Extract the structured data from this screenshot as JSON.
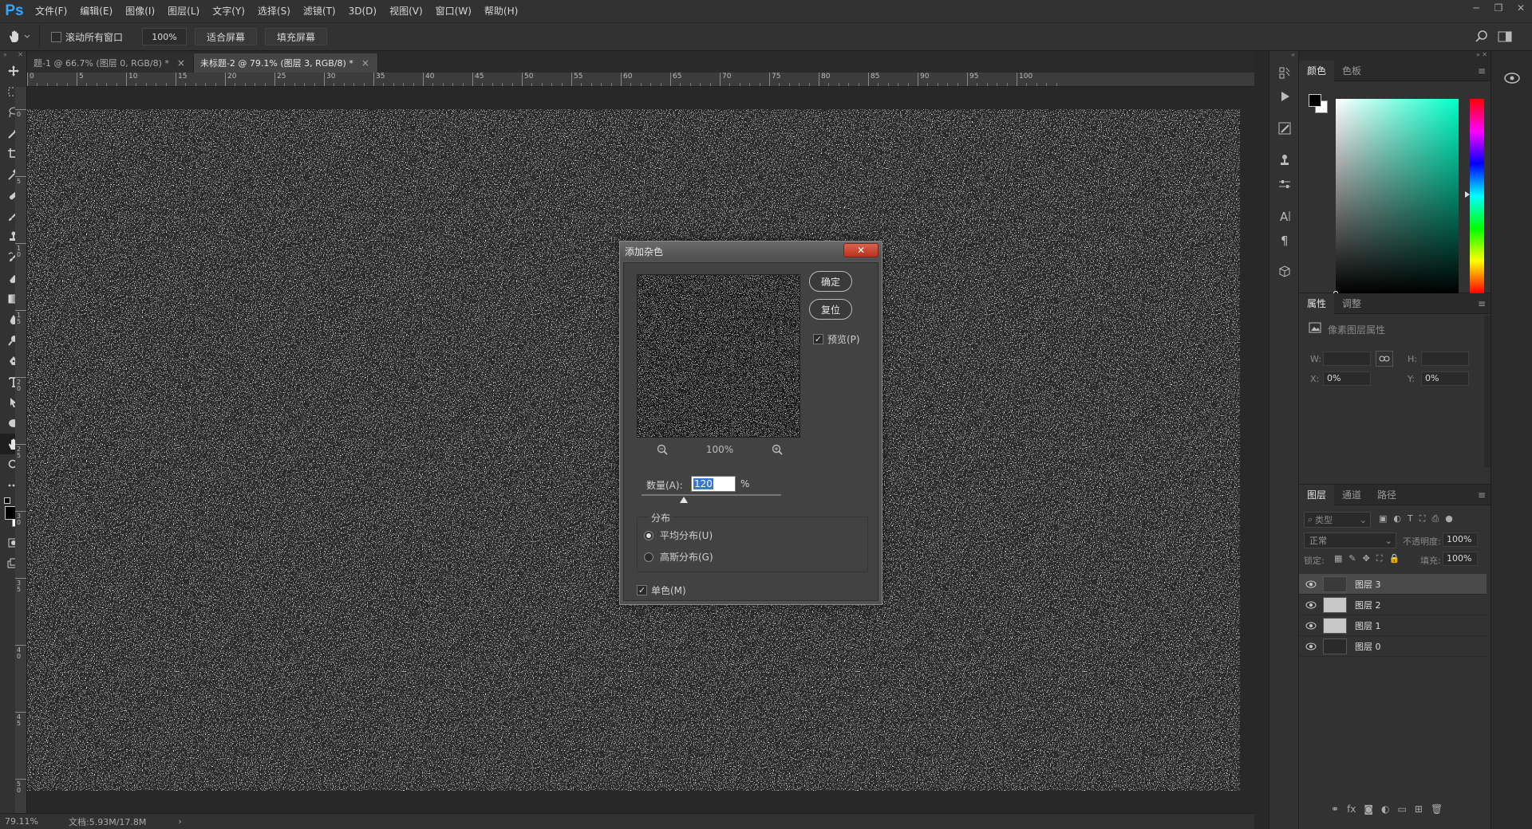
{
  "app": {
    "logo": "Ps"
  },
  "menu": [
    "文件(F)",
    "编辑(E)",
    "图像(I)",
    "图层(L)",
    "文字(Y)",
    "选择(S)",
    "滤镜(T)",
    "3D(D)",
    "视图(V)",
    "窗口(W)",
    "帮助(H)"
  ],
  "options": {
    "scroll_all_label": "滚动所有窗口",
    "zoom_value": "100%",
    "fit_screen_label": "适合屏幕",
    "fill_screen_label": "填充屏幕"
  },
  "tabs": [
    {
      "label": "题-1 @ 66.7% (图层 0, RGB/8) *",
      "active": false
    },
    {
      "label": "未标题-2 @ 79.1% (图层 3, RGB/8) *",
      "active": true
    }
  ],
  "ruler_h": [
    "0",
    "5",
    "10",
    "15",
    "20",
    "25",
    "30",
    "35",
    "40",
    "45",
    "50",
    "55",
    "60",
    "65",
    "70",
    "75",
    "80",
    "85",
    "90",
    "95",
    "100"
  ],
  "ruler_v": [
    "0",
    "5",
    "10",
    "15",
    "20",
    "25",
    "30",
    "35",
    "40",
    "45",
    "50"
  ],
  "status": {
    "zoom": "79.11%",
    "doc": "文档:5.93M/17.8M"
  },
  "dialog": {
    "title": "添加杂色",
    "ok_label": "确定",
    "reset_label": "复位",
    "preview_label": "预览(P)",
    "preview_checked": true,
    "zoom": "100%",
    "amount_label": "数量(A):",
    "amount_value": "120",
    "amount_unit": "%",
    "amount_slider_fraction": 0.3,
    "distribution_legend": "分布",
    "uniform_label": "平均分布(U)",
    "gaussian_label": "高斯分布(G)",
    "distribution_selected": "uniform",
    "monochrome_label": "单色(M)",
    "monochrome_checked": true
  },
  "color_panel": {
    "tabs": [
      "颜色",
      "色板"
    ],
    "foreground": "#000000",
    "background": "#ffffff",
    "hue": "#00ffc8"
  },
  "props_panel": {
    "tabs": [
      "属性",
      "调整"
    ],
    "title": "像素图层属性",
    "w_label": "W:",
    "h_label": "H:",
    "x_label": "X:",
    "x_value": "0%",
    "y_label": "Y:",
    "y_value": "0%"
  },
  "layers_panel": {
    "tabs": [
      "图层",
      "通道",
      "路径"
    ],
    "filter_label": "类型",
    "blend_mode": "正常",
    "opacity_label": "不透明度:",
    "opacity_value": "100%",
    "lock_label": "锁定:",
    "fill_label": "填充:",
    "fill_value": "100%",
    "layers": [
      {
        "name": "图层 3",
        "selected": true,
        "thumb": "#3a3a3a"
      },
      {
        "name": "图层 2",
        "selected": false,
        "thumb": "#c8c8c8"
      },
      {
        "name": "图层 1",
        "selected": false,
        "thumb": "#c8c8c8"
      },
      {
        "name": "图层 0",
        "selected": false,
        "thumb": "#2a2a2a"
      }
    ]
  }
}
